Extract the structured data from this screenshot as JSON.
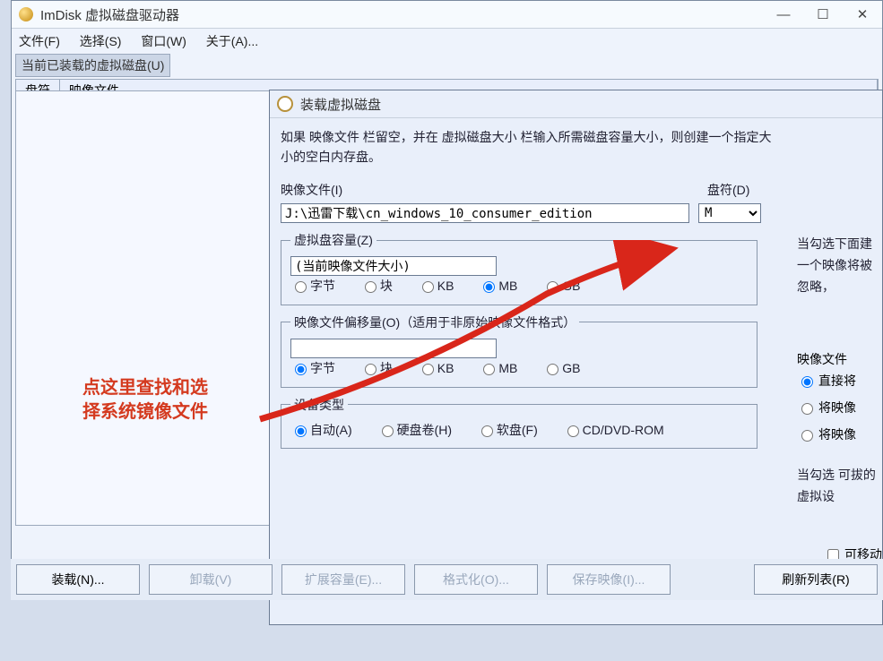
{
  "window": {
    "title": "ImDisk 虚拟磁盘驱动器",
    "menu": {
      "file": "文件(F)",
      "select": "选择(S)",
      "window": "窗口(W)",
      "about": "关于(A)..."
    },
    "section": "当前已装载的虚拟磁盘(U)",
    "cols": {
      "letter": "盘符",
      "image": "映像文件"
    },
    "buttons": {
      "mount": "装载(N)...",
      "unmount": "卸载(V)",
      "extend": "扩展容量(E)...",
      "format": "格式化(O)...",
      "save": "保存映像(I)...",
      "refresh": "刷新列表(R)"
    }
  },
  "dialog": {
    "title": "装载虚拟磁盘",
    "desc1": "如果 映像文件 栏留空，并在 虚拟磁盘大小 栏输入所需磁盘容量大小，则创建一个指定大小的空白内存盘。",
    "imageLabel": "映像文件(I)",
    "imagePath": "J:\\迅雷下载\\cn_windows_10_consumer_edition",
    "letterLabel": "盘符(D)",
    "letterValue": "M",
    "sizeGroup": "虚拟盘容量(Z)",
    "sizeValue": "(当前映像文件大小)",
    "units": {
      "byte": "字节",
      "block": "块",
      "kb": "KB",
      "mb": "MB",
      "gb": "GB"
    },
    "offsetGroup": "映像文件偏移量(O)（适用于非原始映像文件格式）",
    "deviceGroup": "设备类型",
    "device": {
      "auto": "自动(A)",
      "hdd": "硬盘卷(H)",
      "floppy": "软盘(F)",
      "cd": "CD/DVD-ROM"
    },
    "rightNote1": "当勾选下面建一个映像将被忽略，",
    "rightOptLabel": "映像文件",
    "rightOpts": {
      "a": "直接将",
      "b": "将映像",
      "c": "将映像"
    },
    "rightNote2": "当勾选 可拔的虚拟设",
    "removable": "可移动"
  },
  "annotation": {
    "l1": "点这里查找和选",
    "l2": "择系统镜像文件"
  }
}
